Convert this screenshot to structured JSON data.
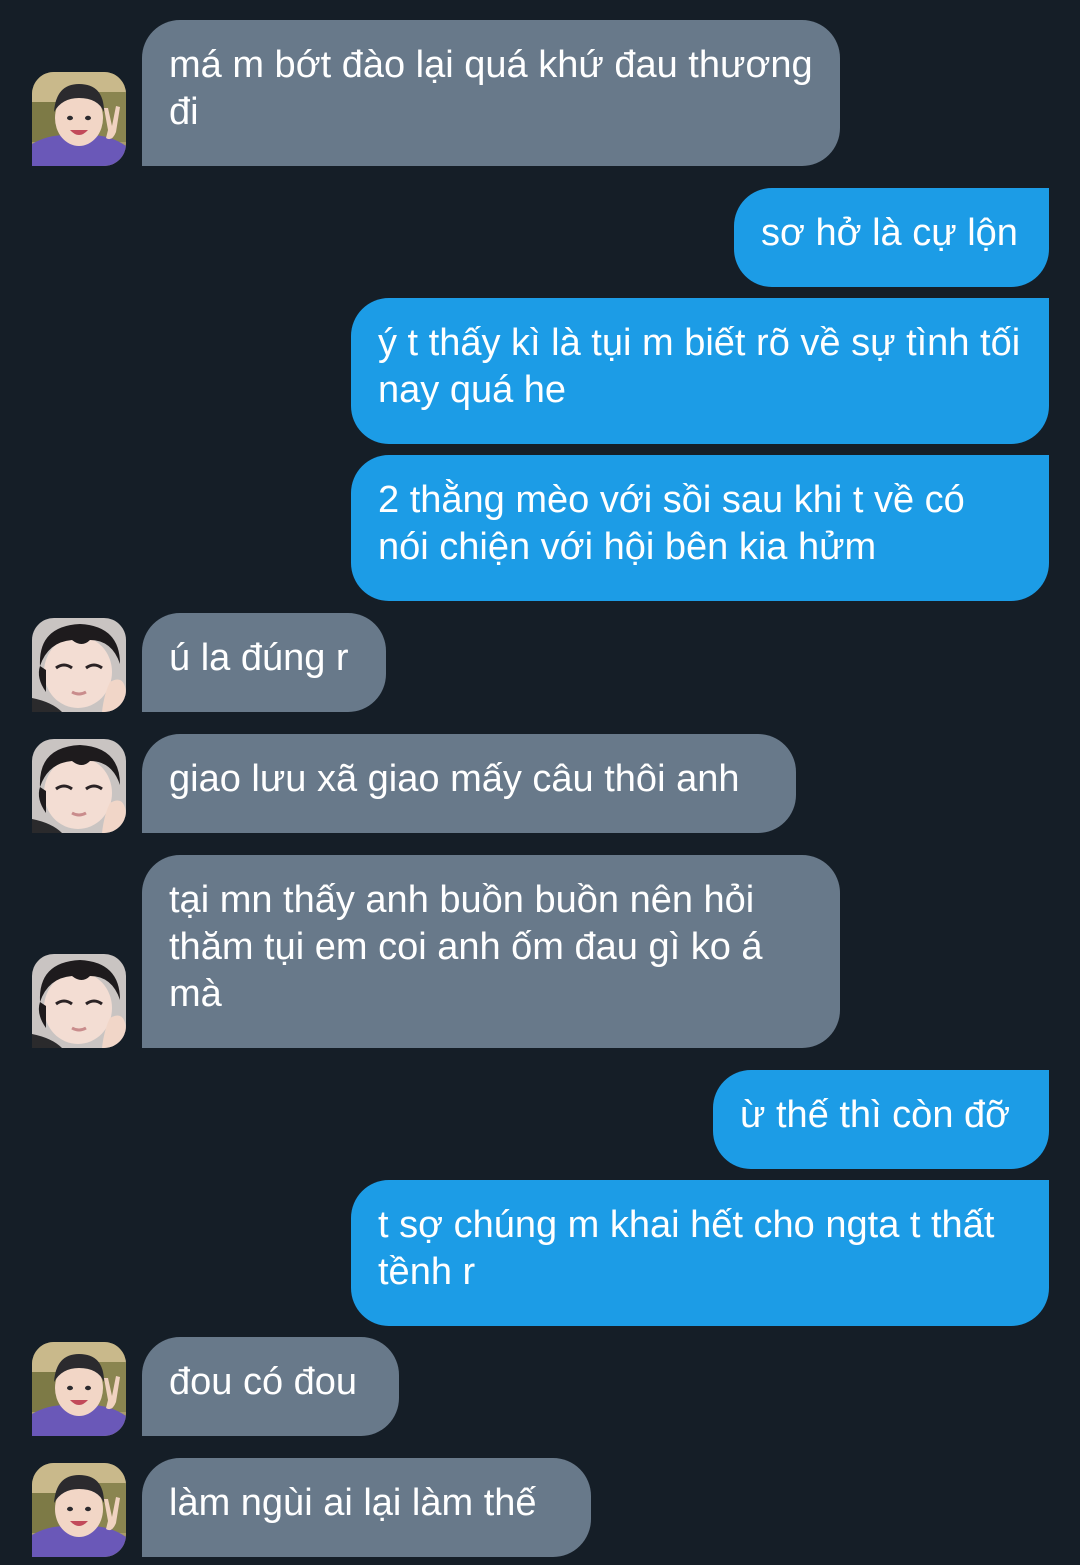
{
  "conversation": {
    "messages": [
      {
        "sender": "other",
        "avatar": "boy-peace-sign-avatar",
        "text": "má m bớt đào lại quá khứ đau thương đi"
      },
      {
        "sender": "me",
        "text": "sơ hở là cự lộn"
      },
      {
        "sender": "me",
        "text": "ý t thấy kì là tụi m biết rõ về sự tình tối nay quá he"
      },
      {
        "sender": "me",
        "text": "2 thằng mèo với sồi sau khi t về có nói chiện với hội bên kia hửm"
      },
      {
        "sender": "other",
        "avatar": "boy-selfie-avatar",
        "text": "ú la đúng r"
      },
      {
        "sender": "other",
        "avatar": "boy-selfie-avatar",
        "text": "giao lưu xã giao mấy câu thôi anh"
      },
      {
        "sender": "other",
        "avatar": "boy-selfie-avatar",
        "text": "tại mn thấy anh buồn buồn nên hỏi thăm tụi em coi anh ốm đau gì ko á mà"
      },
      {
        "sender": "me",
        "text": "ừ thế thì còn đỡ"
      },
      {
        "sender": "me",
        "text": "t sợ chúng m khai hết cho ngta t thất tềnh r"
      },
      {
        "sender": "other",
        "avatar": "boy-peace-sign-avatar",
        "text": "đou có đou"
      },
      {
        "sender": "other",
        "avatar": "boy-peace-sign-avatar",
        "text": "làm ngùi ai lại làm thế"
      }
    ]
  },
  "colors": {
    "background": "#151e27",
    "incoming_bubble": "#68798a",
    "outgoing_bubble": "#1c9ce6",
    "text": "#ffffff"
  }
}
